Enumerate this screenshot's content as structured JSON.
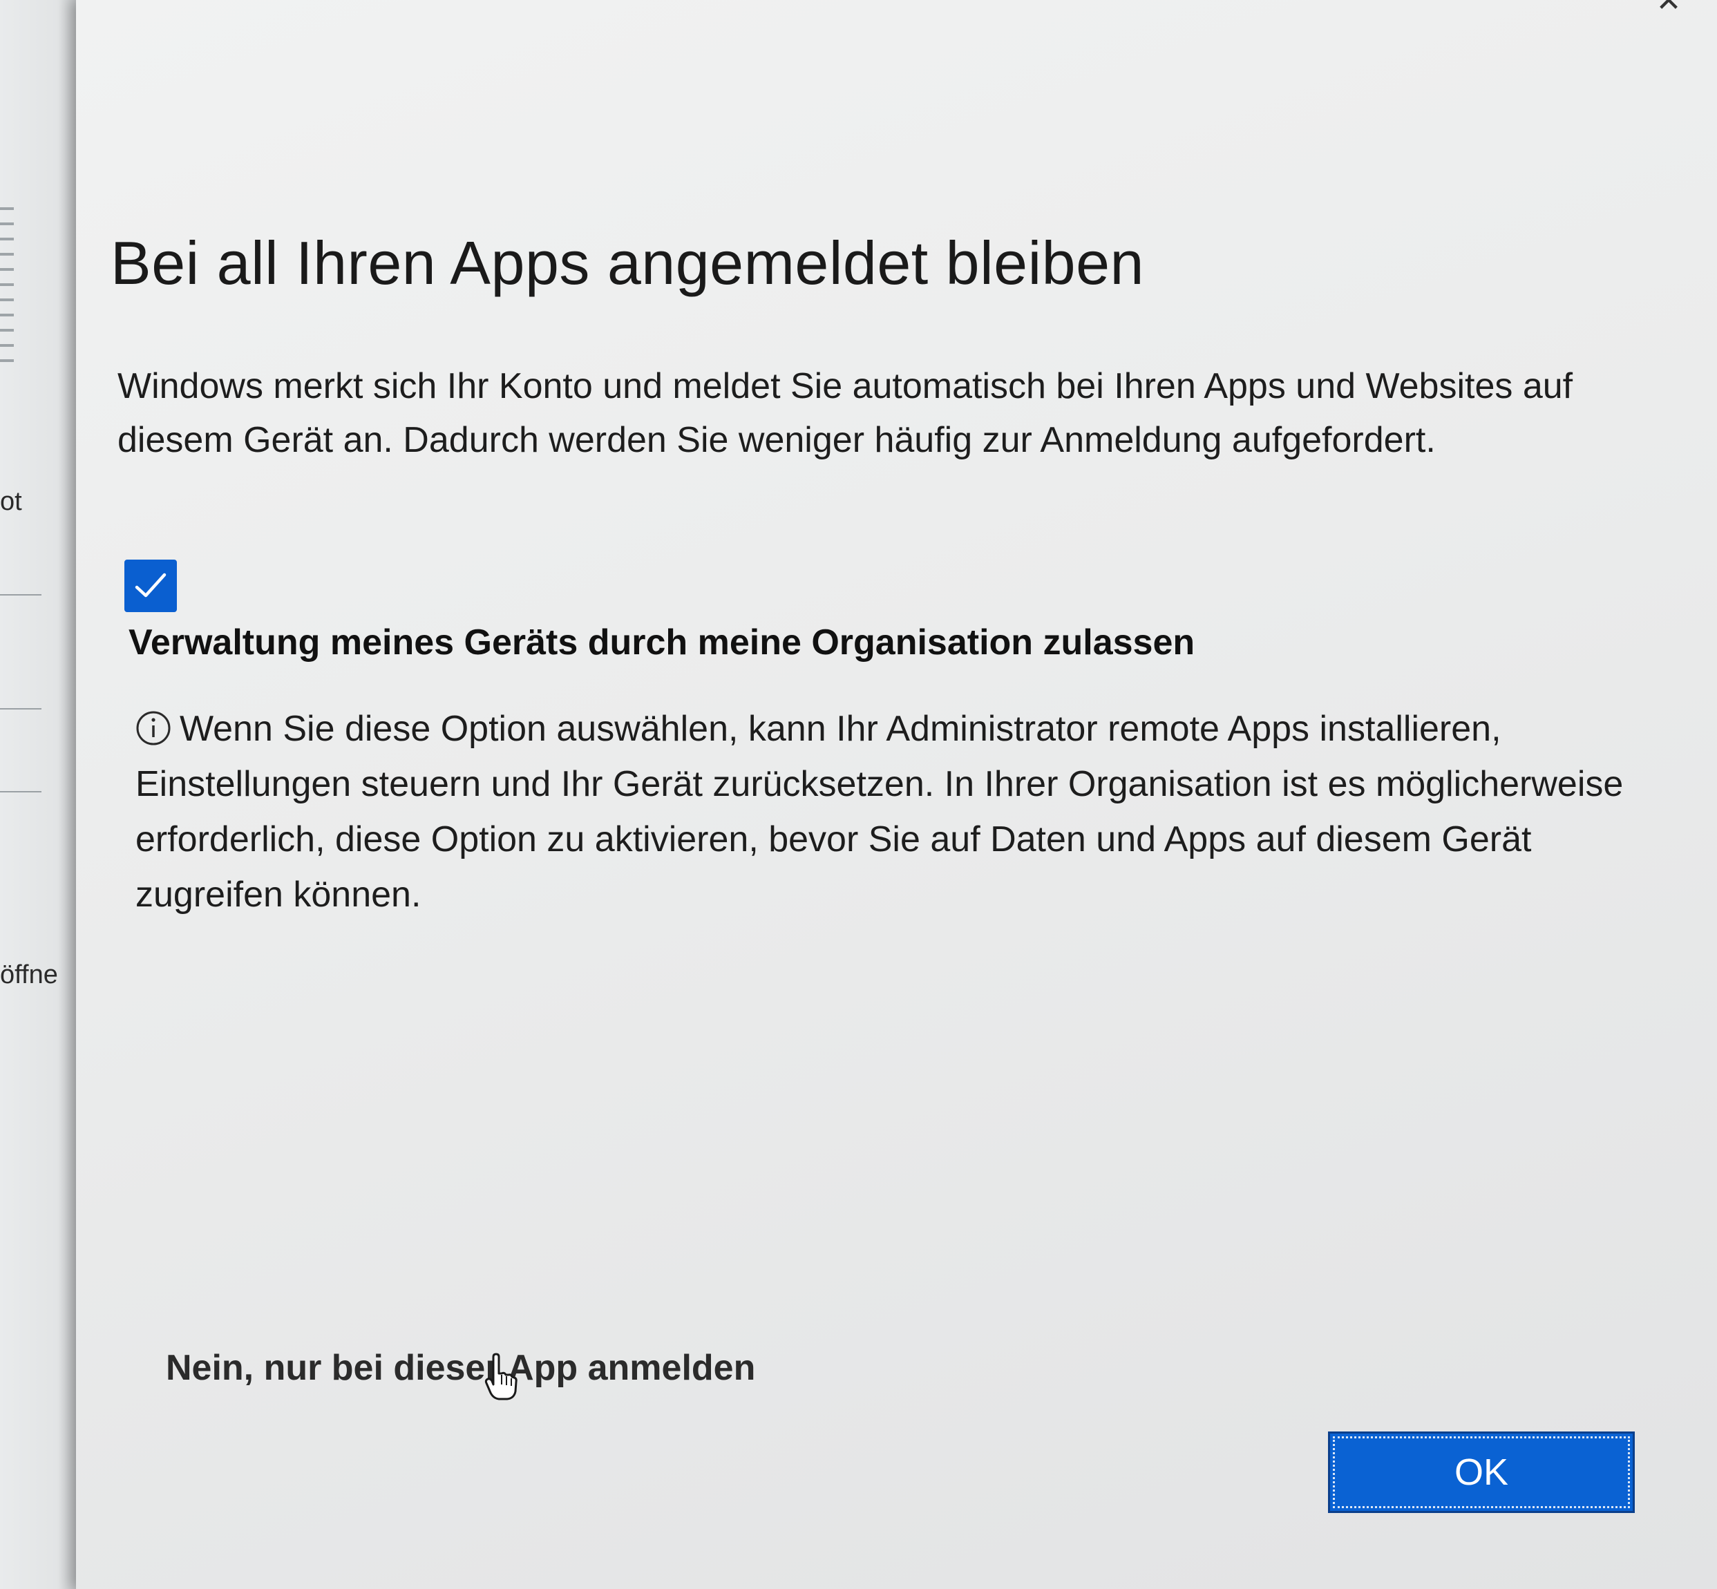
{
  "background": {
    "fragment_top": "ot",
    "fragment_bottom": "öffne"
  },
  "dialog": {
    "close_icon": "close-icon",
    "title": "Bei all Ihren Apps angemeldet bleiben",
    "description": "Windows merkt sich Ihr Konto und meldet Sie automatisch bei Ihren Apps und Websites auf diesem Gerät an. Dadurch werden Sie weniger häufig zur Anmeldung aufgefordert.",
    "checkbox": {
      "checked": true,
      "label": "Verwaltung meines Geräts durch meine Organisation zulassen"
    },
    "info": {
      "icon": "info-icon",
      "text": "Wenn Sie diese Option auswählen, kann Ihr Administrator remote Apps installieren, Einstellungen steuern und Ihr Gerät zurücksetzen. In Ihrer Organisation ist es möglicherweise erforderlich, diese Option zu aktivieren, bevor Sie auf Daten und Apps auf diesem Gerät zugreifen können."
    },
    "decline_link": "Nein, nur bei dieser App anmelden",
    "ok_button": "OK"
  },
  "colors": {
    "accent": "#0a62d3",
    "dialog_bg": "#ebecec",
    "text": "#1b1b1b"
  }
}
